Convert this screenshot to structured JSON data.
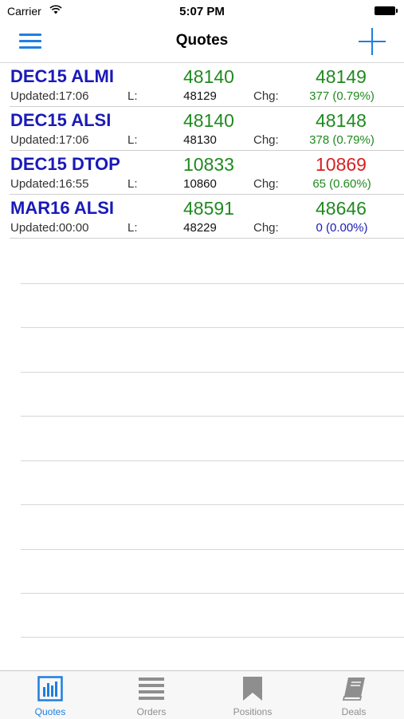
{
  "status": {
    "carrier": "Carrier",
    "time": "5:07 PM"
  },
  "nav": {
    "title": "Quotes"
  },
  "labels": {
    "low": "L:",
    "chg": "Chg:"
  },
  "quotes": [
    {
      "name": "DEC15 ALMI",
      "bid": "48140",
      "ask": "48149",
      "ask_color": "green",
      "updated": "Updated:17:06",
      "low": "48129",
      "change": "377  (0.79%)",
      "change_color": "green"
    },
    {
      "name": "DEC15 ALSI",
      "bid": "48140",
      "ask": "48148",
      "ask_color": "green",
      "updated": "Updated:17:06",
      "low": "48130",
      "change": "378  (0.79%)",
      "change_color": "green"
    },
    {
      "name": "DEC15 DTOP",
      "bid": "10833",
      "ask": "10869",
      "ask_color": "red",
      "updated": "Updated:16:55",
      "low": "10860",
      "change": "65  (0.60%)",
      "change_color": "green"
    },
    {
      "name": "MAR16 ALSI",
      "bid": "48591",
      "ask": "48646",
      "ask_color": "green",
      "updated": "Updated:00:00",
      "low": "48229",
      "change": "0  (0.00%)",
      "change_color": "blue"
    }
  ],
  "tabs": [
    {
      "label": "Quotes",
      "icon": "bar-chart-icon",
      "active": true
    },
    {
      "label": "Orders",
      "icon": "list-icon",
      "active": false
    },
    {
      "label": "Positions",
      "icon": "bookmark-icon",
      "active": false
    },
    {
      "label": "Deals",
      "icon": "book-icon",
      "active": false
    }
  ],
  "colors": {
    "accent": "#1e7fe0",
    "name": "#1a1ab8",
    "up": "#1f8a1f",
    "down": "#d91f1f",
    "tab_inactive": "#8e8e8e"
  }
}
